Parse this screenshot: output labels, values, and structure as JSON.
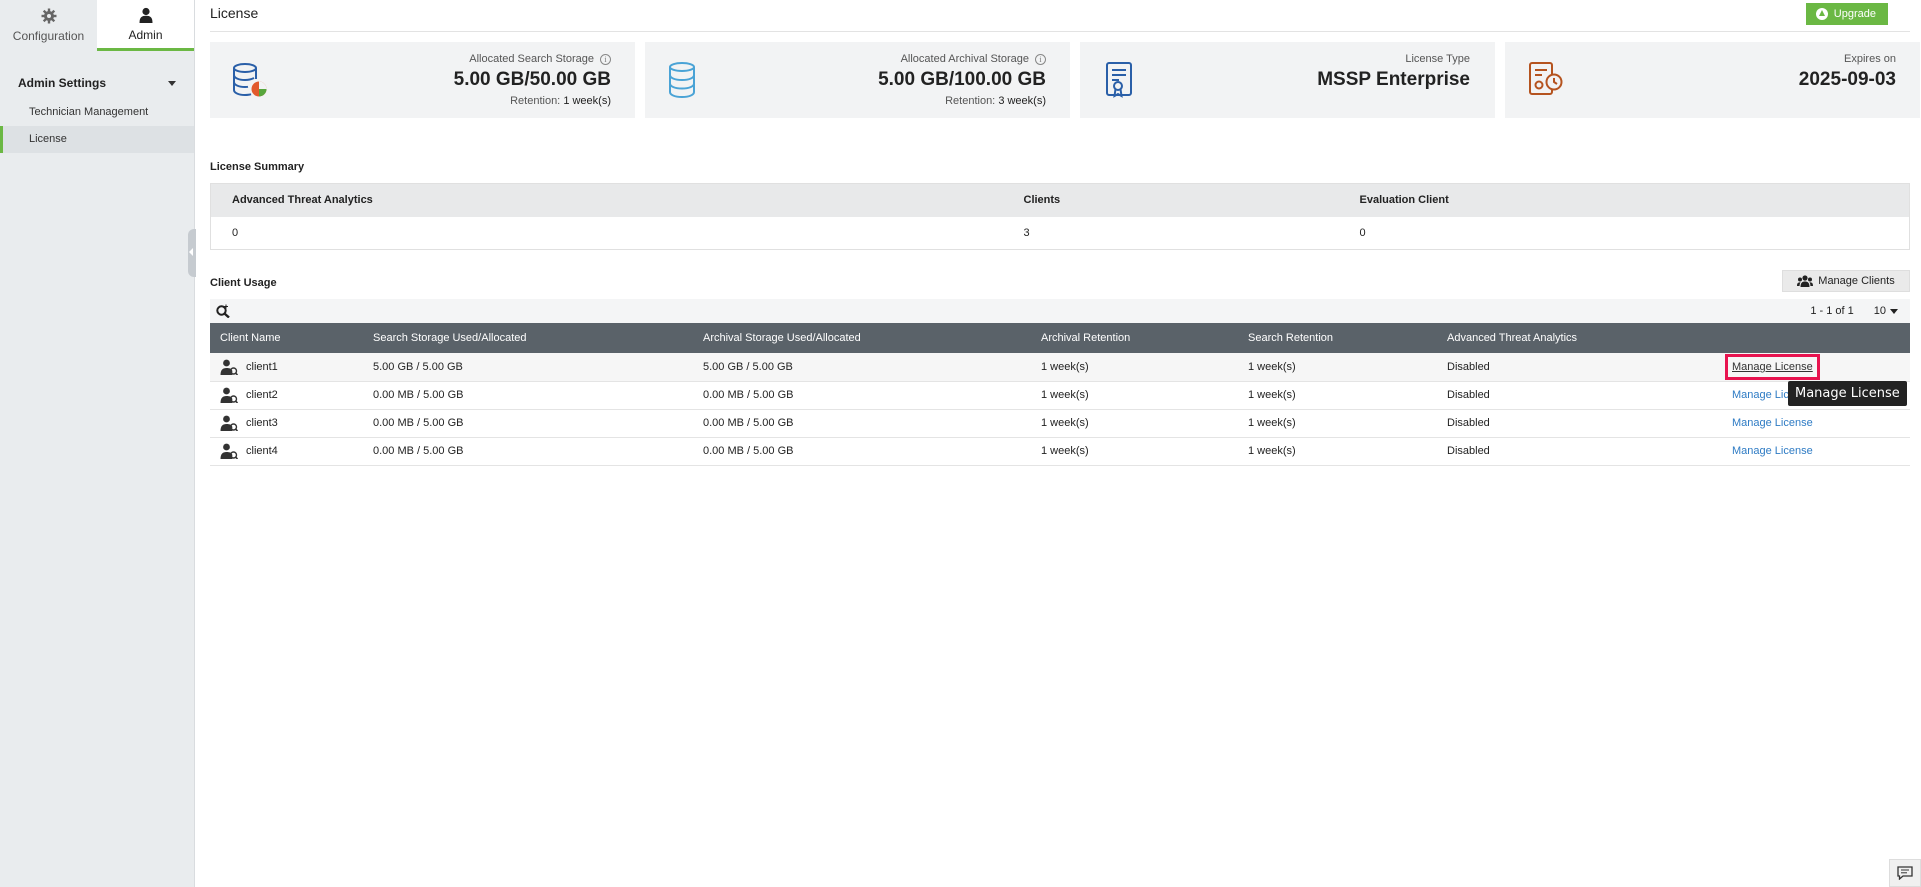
{
  "sidebar": {
    "tabs": [
      {
        "label": "Configuration",
        "icon": "gear-icon"
      },
      {
        "label": "Admin",
        "icon": "user-icon"
      }
    ],
    "section_title": "Admin Settings",
    "items": [
      {
        "label": "Technician Management"
      },
      {
        "label": "License"
      }
    ]
  },
  "header": {
    "title": "License",
    "upgrade_label": "Upgrade"
  },
  "cards": [
    {
      "label": "Allocated Search Storage",
      "value": "5.00 GB/50.00 GB",
      "retention_label": "Retention:",
      "retention_value": "1 week(s)",
      "icon": "database-pie-icon"
    },
    {
      "label": "Allocated Archival Storage",
      "value": "5.00 GB/100.00 GB",
      "retention_label": "Retention:",
      "retention_value": "3 week(s)",
      "icon": "database-icon"
    },
    {
      "label": "License Type",
      "value": "MSSP Enterprise",
      "icon": "license-certificate-icon"
    },
    {
      "label": "Expires on",
      "value": "2025-09-03",
      "icon": "license-expiry-icon"
    }
  ],
  "summary": {
    "title": "License Summary",
    "columns": [
      "Advanced Threat Analytics",
      "Clients",
      "Evaluation Client"
    ],
    "values": [
      "0",
      "3",
      "0"
    ]
  },
  "client_usage": {
    "title": "Client Usage",
    "manage_clients_label": "Manage Clients",
    "pagination": "1 - 1 of 1",
    "per_page": "10",
    "columns": [
      "Client Name",
      "Search Storage Used/Allocated",
      "Archival Storage Used/Allocated",
      "Archival Retention",
      "Search Retention",
      "Advanced Threat Analytics",
      ""
    ],
    "rows": [
      {
        "name": "client1",
        "search": "5.00 GB / 5.00 GB",
        "archival": "5.00 GB / 5.00 GB",
        "archival_retention": "1 week(s)",
        "search_retention": "1 week(s)",
        "ata": "Disabled",
        "action": "Manage License"
      },
      {
        "name": "client2",
        "search": "0.00 MB / 5.00 GB",
        "archival": "0.00 MB / 5.00 GB",
        "archival_retention": "1 week(s)",
        "search_retention": "1 week(s)",
        "ata": "Disabled",
        "action": "Manage License"
      },
      {
        "name": "client3",
        "search": "0.00 MB / 5.00 GB",
        "archival": "0.00 MB / 5.00 GB",
        "archival_retention": "1 week(s)",
        "search_retention": "1 week(s)",
        "ata": "Disabled",
        "action": "Manage License"
      },
      {
        "name": "client4",
        "search": "0.00 MB / 5.00 GB",
        "archival": "0.00 MB / 5.00 GB",
        "archival_retention": "1 week(s)",
        "search_retention": "1 week(s)",
        "ata": "Disabled",
        "action": "Manage License"
      }
    ]
  },
  "tooltip": "Manage License",
  "colors": {
    "accent": "#6bb844",
    "link": "#2e7bc4",
    "highlight": "#e8134f",
    "table_header": "#5a6269"
  }
}
